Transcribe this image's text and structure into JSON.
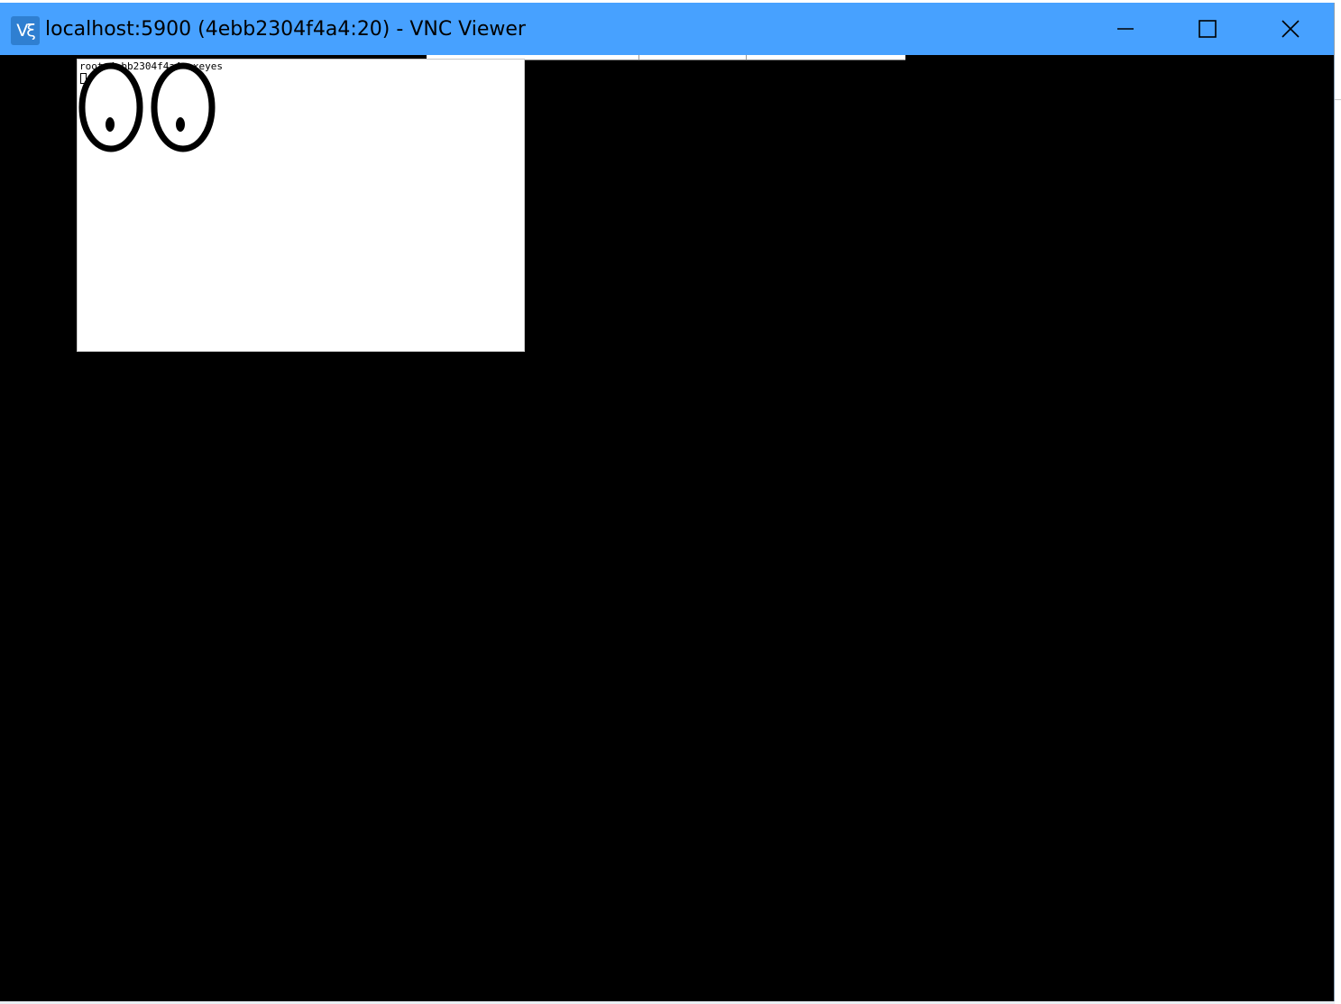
{
  "window": {
    "title": "localhost:5900 (4ebb2304f4a4:20) - VNC Viewer",
    "logo_text": "Vξ",
    "titlebar_color": "#47a1ff",
    "controls": {
      "minimize_icon": "minimize-icon",
      "maximize_icon": "maximize-icon",
      "close_icon": "close-icon"
    }
  },
  "remote_desktop": {
    "background_color": "#000000",
    "xeyes_window": {
      "title": "root@4ebb2304f4a4: xeyes",
      "icon": "eyes-icon"
    }
  }
}
